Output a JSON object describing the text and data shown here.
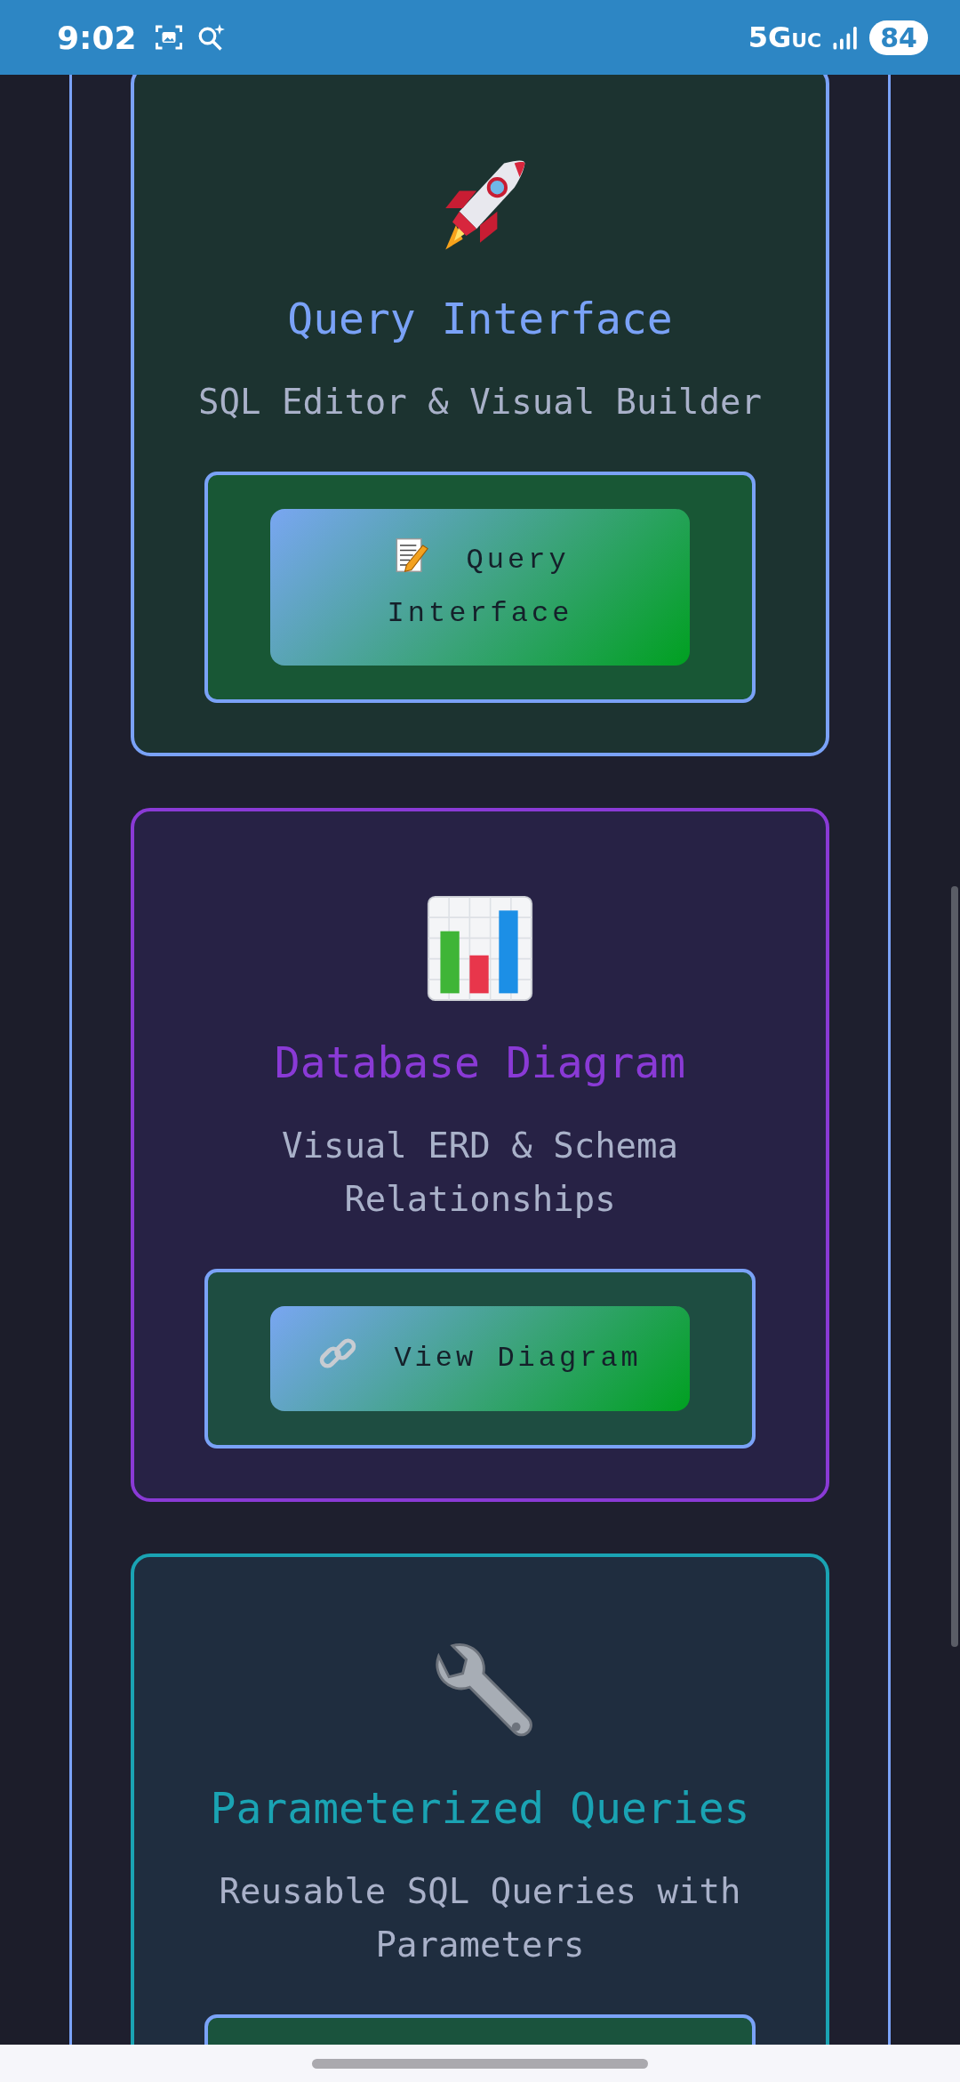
{
  "status_bar": {
    "time": "9:02",
    "network": "5G$_{UC}$",
    "battery": "84"
  },
  "cards": [
    {
      "kind": "rocket",
      "title": "Query Interface",
      "subtitle": "SQL Editor & Visual Builder",
      "color": "#7aa2f7",
      "button": {
        "kind": "memo",
        "label": "Query Interface"
      }
    },
    {
      "kind": "chart",
      "title": "Database Diagram",
      "subtitle": "Visual ERD & Schema Relationships",
      "color": "#8a3ad6",
      "button": {
        "kind": "link",
        "label": "View Diagram"
      }
    },
    {
      "kind": "wrench",
      "title": "Parameterized Queries",
      "subtitle": "Reusable SQL Queries with Parameters",
      "color": "#1aa3b3"
    }
  ]
}
